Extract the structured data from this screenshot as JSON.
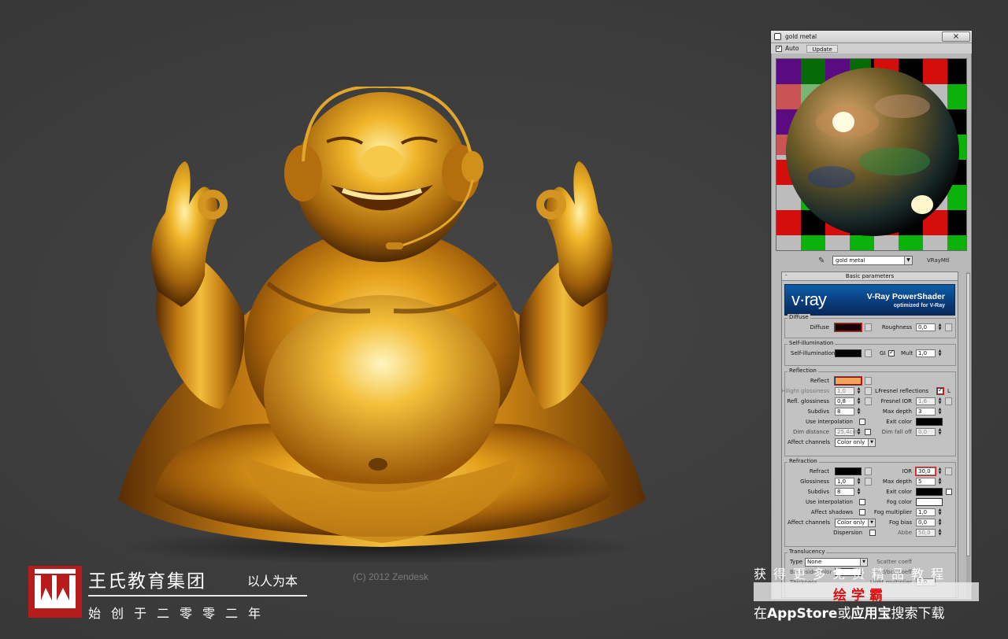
{
  "copyright": "(C) 2012 Zendesk",
  "material_editor": {
    "title": "gold metal",
    "close_label": "×",
    "auto_label": "Auto",
    "auto_checked": true,
    "update_label": "Update",
    "material_name": "gold metal",
    "material_type": "VRayMtl",
    "rollout_title": "Basic parameters",
    "rollout_toggle": "-",
    "banner": {
      "logo": "v·ray",
      "product": "V-Ray PowerShader",
      "tagline": "optimized for V-Ray"
    },
    "diffuse": {
      "group": "Diffuse",
      "diffuse_label": "Diffuse",
      "diffuse_color": "#1a0000",
      "roughness_label": "Roughness",
      "roughness_value": "0,0"
    },
    "self_illum": {
      "group": "Self-illumination",
      "label": "Self-illumination",
      "color": "#050505",
      "gi_label": "GI",
      "gi_checked": true,
      "mult_label": "Mult",
      "mult_value": "1,0"
    },
    "reflection": {
      "group": "Reflection",
      "reflect_label": "Reflect",
      "reflect_color": "#f2a45a",
      "hilight_label": "Hilight glossiness",
      "hilight_value": "1,0",
      "l_label": "L",
      "fresnel_label": "Fresnel reflections",
      "fresnel_checked": true,
      "refl_gloss_label": "Refl. glossiness",
      "refl_gloss_value": "0,8",
      "fresnel_ior_label": "Fresnel IOR",
      "fresnel_ior_value": "1,6",
      "subdivs_label": "Subdivs",
      "subdivs_value": "8",
      "max_depth_label": "Max depth",
      "max_depth_value": "3",
      "use_interp_label": "Use interpolation",
      "exit_color_label": "Exit color",
      "exit_color": "#000000",
      "dim_distance_label": "Dim distance",
      "dim_distance_value": "25,4cm",
      "dim_falloff_label": "Dim fall off",
      "dim_falloff_value": "0,0",
      "affect_channels_label": "Affect channels",
      "affect_channels_value": "Color only"
    },
    "refraction": {
      "group": "Refraction",
      "refract_label": "Refract",
      "refract_color": "#000000",
      "ior_label": "IOR",
      "ior_value": "30,0",
      "glossiness_label": "Glossiness",
      "glossiness_value": "1,0",
      "max_depth_label": "Max depth",
      "max_depth_value": "5",
      "subdivs_label": "Subdivs",
      "subdivs_value": "8",
      "exit_color_label": "Exit color",
      "use_interp_label": "Use interpolation",
      "fog_color_label": "Fog color",
      "fog_color": "#ffffff",
      "affect_shadows_label": "Affect shadows",
      "fog_mult_label": "Fog multiplier",
      "fog_mult_value": "1,0",
      "affect_channels_label": "Affect channels",
      "affect_channels_value": "Color only",
      "fog_bias_label": "Fog bias",
      "fog_bias_value": "0,0",
      "dispersion_label": "Dispersion",
      "abbe_label": "Abbe",
      "abbe_value": "50,0"
    },
    "translucency": {
      "group": "Translucency",
      "type_label": "Type",
      "type_value": "None",
      "scatter_label": "Scatter coeff",
      "back_label": "Back-side color",
      "fwd_label": "Fwd/bck coeff",
      "thickness_label": "Thickness",
      "light_mult_label": "Light multiplier",
      "light_mult_value": "1,0"
    }
  },
  "brand": {
    "name": "王氏教育集团",
    "slogan": "以人为本",
    "founded": "始创于二零零二年"
  },
  "promo": {
    "top": "获得更多免费精品教程",
    "app_name": "绘学霸",
    "bottom_pre": "在",
    "bottom_store1": "AppStore",
    "bottom_mid": "或",
    "bottom_store2": "应用宝",
    "bottom_post": "搜索下载"
  }
}
